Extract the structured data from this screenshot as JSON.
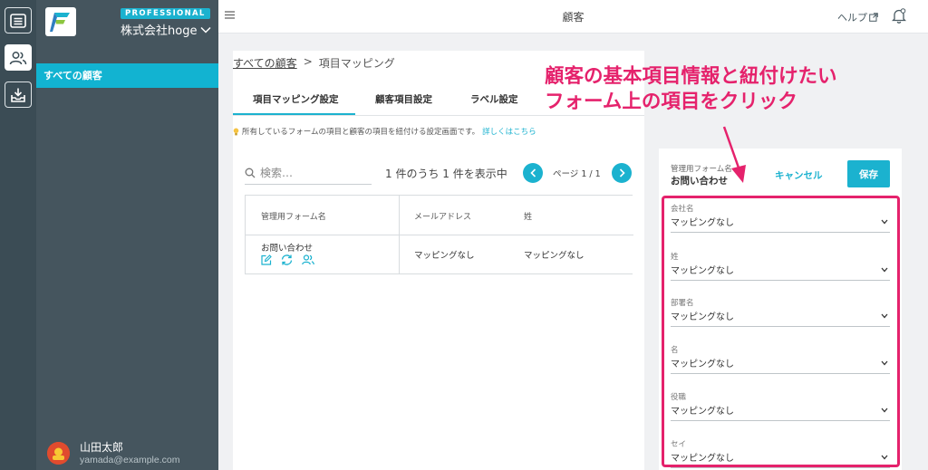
{
  "rail": {
    "items": [
      {
        "icon": "list-icon"
      },
      {
        "icon": "people-icon",
        "active": true
      },
      {
        "icon": "inbox-download-icon"
      }
    ]
  },
  "sidebar": {
    "plan_badge": "PROFESSIONAL",
    "company_name": "株式会社hoge",
    "items": [
      {
        "label": "すべての顧客",
        "active": true
      }
    ],
    "user": {
      "name": "山田太郎",
      "email": "yamada@example.com"
    }
  },
  "header": {
    "title": "顧客",
    "help_label": "ヘルプ"
  },
  "main": {
    "breadcrumb": {
      "parent": "すべての顧客",
      "separator": ">",
      "current": "項目マッピング"
    },
    "tabs": [
      {
        "label": "項目マッピング設定",
        "active": true
      },
      {
        "label": "顧客項目設定"
      },
      {
        "label": "ラベル設定"
      }
    ],
    "info_text": "所有しているフォームの項目と顧客の項目を紐付ける設定画面です。",
    "info_link": "詳しくはこちら",
    "search_placeholder": "検索…",
    "count_text": "1 件のうち 1 件を表示中",
    "page_text": "ページ 1 / 1",
    "table": {
      "headers": [
        "管理用フォーム名",
        "メールアドレス",
        "姓"
      ],
      "rows": [
        {
          "form_name": "お問い合わせ",
          "email": "マッピングなし",
          "last_name": "マッピングなし"
        }
      ]
    }
  },
  "panel": {
    "form_name_label": "管理用フォーム名",
    "form_name_value": "お問い合わせ",
    "cancel_label": "キャンセル",
    "save_label": "保存",
    "fields": [
      {
        "label": "会社名",
        "value": "マッピングなし"
      },
      {
        "label": "姓",
        "value": "マッピングなし"
      },
      {
        "label": "部署名",
        "value": "マッピングなし"
      },
      {
        "label": "名",
        "value": "マッピングなし"
      },
      {
        "label": "役職",
        "value": "マッピングなし"
      },
      {
        "label": "セイ",
        "value": "マッピングなし"
      }
    ]
  },
  "annotation": {
    "line1": "顧客の基本項目情報と紐付けたい",
    "line2": "フォーム上の項目をクリック",
    "color": "#e5226c"
  },
  "colors": {
    "accent": "#1bb2cf",
    "sidebar": "#45555e",
    "rail": "#3b4c55",
    "annotation": "#e5226c"
  }
}
